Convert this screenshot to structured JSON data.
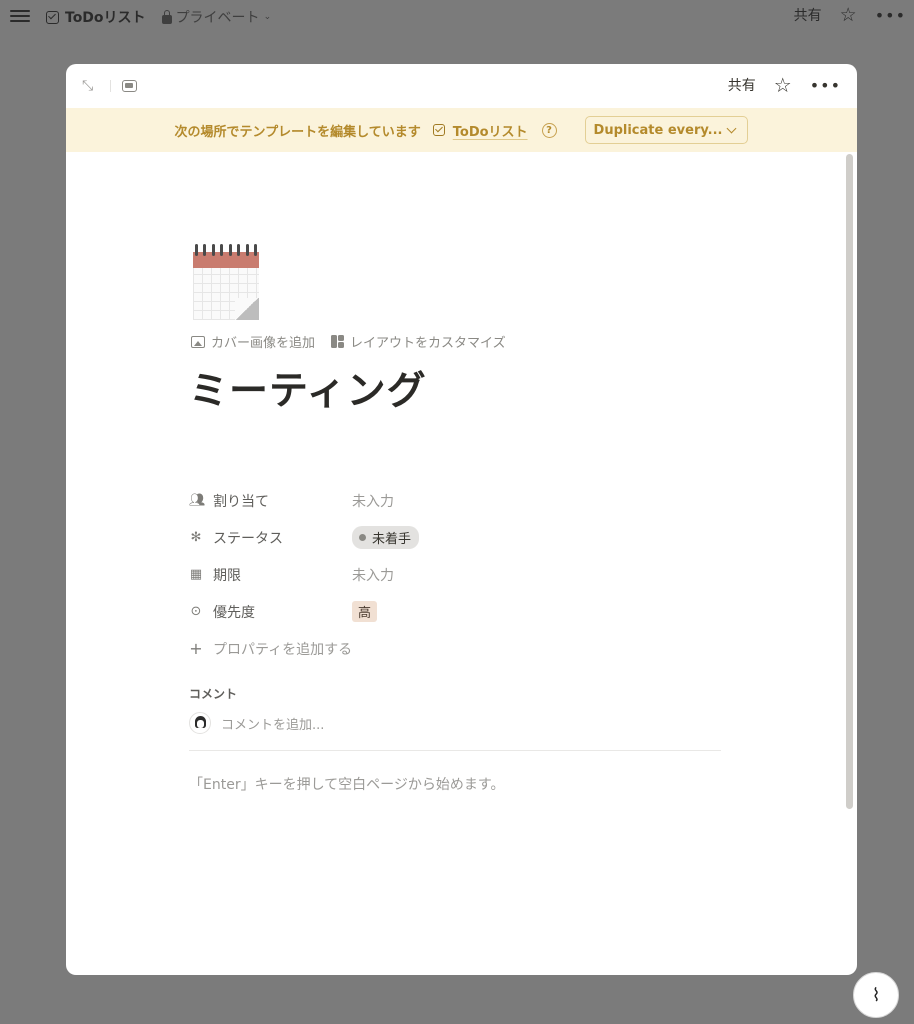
{
  "topbar": {
    "title": "ToDoリスト",
    "privacy": "プライベート",
    "share": "共有"
  },
  "modal": {
    "share": "共有",
    "banner": {
      "text": "次の場所でテンプレートを編集しています",
      "link": "ToDoリスト",
      "help": "?",
      "duplicate": "Duplicate every..."
    },
    "add_cover": "カバー画像を追加",
    "customize_layout": "レイアウトをカスタマイズ",
    "page_title": "ミーティング",
    "properties": [
      {
        "icon": "people-icon",
        "name": "割り当て",
        "value": "未入力"
      },
      {
        "icon": "status-icon",
        "name": "ステータス",
        "value": "未着手"
      },
      {
        "icon": "calendar-icon",
        "name": "期限",
        "value": "未入力"
      },
      {
        "icon": "priority-icon",
        "name": "優先度",
        "value": "高"
      }
    ],
    "add_property": "プロパティを追加する",
    "comments_title": "コメント",
    "comment_placeholder": "コメントを追加...",
    "empty_hint": "「Enter」キーを押して空白ページから始めます。"
  },
  "colors": {
    "banner_bg": "#fbf3db",
    "banner_text": "#b48a2c",
    "priority_tag_bg": "#f1e0d3",
    "status_tag_bg": "#e3e2e0",
    "overlay": "#7b7b7b"
  }
}
